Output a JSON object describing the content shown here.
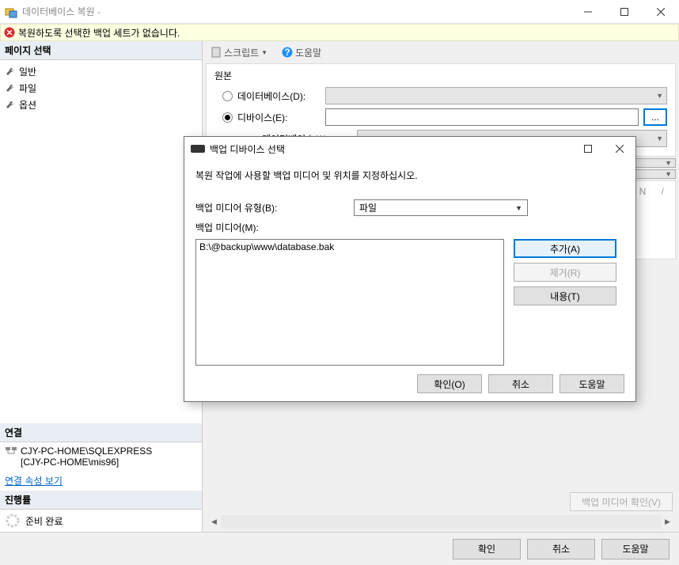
{
  "window": {
    "title": "데이터베이스 복원 -"
  },
  "warning": {
    "message": "복원하도록 선택한 백업 세트가 없습니다."
  },
  "sidebar": {
    "page_select": "페이지 선택",
    "items": [
      {
        "label": "일반"
      },
      {
        "label": "파일"
      },
      {
        "label": "옵션"
      }
    ],
    "connection_header": "연결",
    "server": "CJY-PC-HOME\\SQLEXPRESS",
    "user": "[CJY-PC-HOME\\mis96]",
    "view_props": "연결 속성 보기",
    "progress_header": "진행률",
    "progress_status": "준비 완료"
  },
  "toolbar": {
    "script": "스크립트",
    "help": "도움말"
  },
  "source": {
    "group": "원본",
    "database_radio": "데이터베이스(D):",
    "device_radio": "디바이스(E):",
    "database_label": "데이터베이스(A):",
    "browse": "..."
  },
  "placeholder": {
    "letters": "N   /"
  },
  "verify_btn": "백업 미디어 확인(V)",
  "modal": {
    "title": "백업 디바이스 선택",
    "instruction": "복원 작업에 사용할 백업 미디어 및 위치를 지정하십시오.",
    "media_type_label": "백업 미디어 유형(B):",
    "media_type_value": "파일",
    "media_label": "백업 미디어(M):",
    "list_item": "B:\\@backup\\www\\database.bak",
    "add": "추가(A)",
    "remove": "제거(R)",
    "contents": "내용(T)",
    "ok": "확인(O)",
    "cancel": "취소",
    "help": "도움말"
  },
  "bottom": {
    "ok": "확인",
    "cancel": "취소",
    "help": "도움말"
  }
}
